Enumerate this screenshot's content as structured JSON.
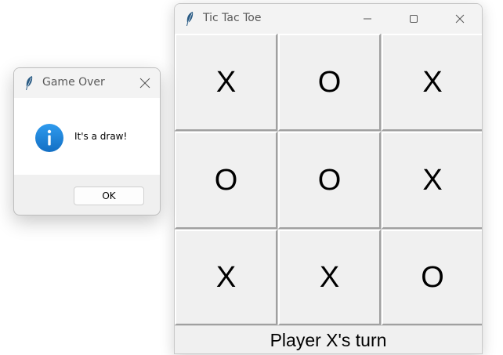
{
  "main_window": {
    "title": "Tic Tac Toe",
    "board": [
      [
        "X",
        "O",
        "X"
      ],
      [
        "O",
        "O",
        "X"
      ],
      [
        "X",
        "X",
        "O"
      ]
    ],
    "status": "Player X's turn"
  },
  "dialog": {
    "title": "Game Over",
    "message": "It's a draw!",
    "ok_label": "OK"
  },
  "icons": {
    "app": "feather-icon",
    "info": "info-icon",
    "minimize": "minimize-icon",
    "maximize": "maximize-icon",
    "close": "close-icon"
  },
  "colors": {
    "info_blue": "#1a7fd6",
    "feather": "#1f5f8b"
  }
}
